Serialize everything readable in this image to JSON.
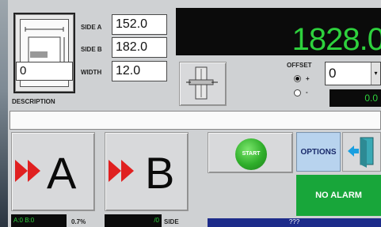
{
  "diagram": {
    "value": "0",
    "caption": "DESCRIPTION"
  },
  "fields": {
    "side_a": {
      "label": "SIDE A",
      "value": "152.0"
    },
    "side_b": {
      "label": "SIDE B",
      "value": "182.0"
    },
    "width": {
      "label": "WIDTH",
      "value": "12.0"
    }
  },
  "display": {
    "main_value": "1828.0",
    "small_value": "0.0"
  },
  "offset": {
    "label": "OFFSET",
    "value": "0",
    "plus": "+",
    "minus": "-"
  },
  "buttons": {
    "a_label": "A",
    "b_label": "B",
    "start": "START",
    "options": "OPTIONS"
  },
  "alarm": {
    "text": "NO ALARM"
  },
  "bottom": {
    "left_status": "A:0 B:0",
    "left_text": "0.7%",
    "mid_status": "/0",
    "mid_text": "SIDE",
    "blue_text": "???"
  },
  "colors": {
    "display_green": "#2ed13d",
    "alarm_green": "#18a63a",
    "arrow_red": "#e02020",
    "options_blue": "#b8d3ee"
  }
}
